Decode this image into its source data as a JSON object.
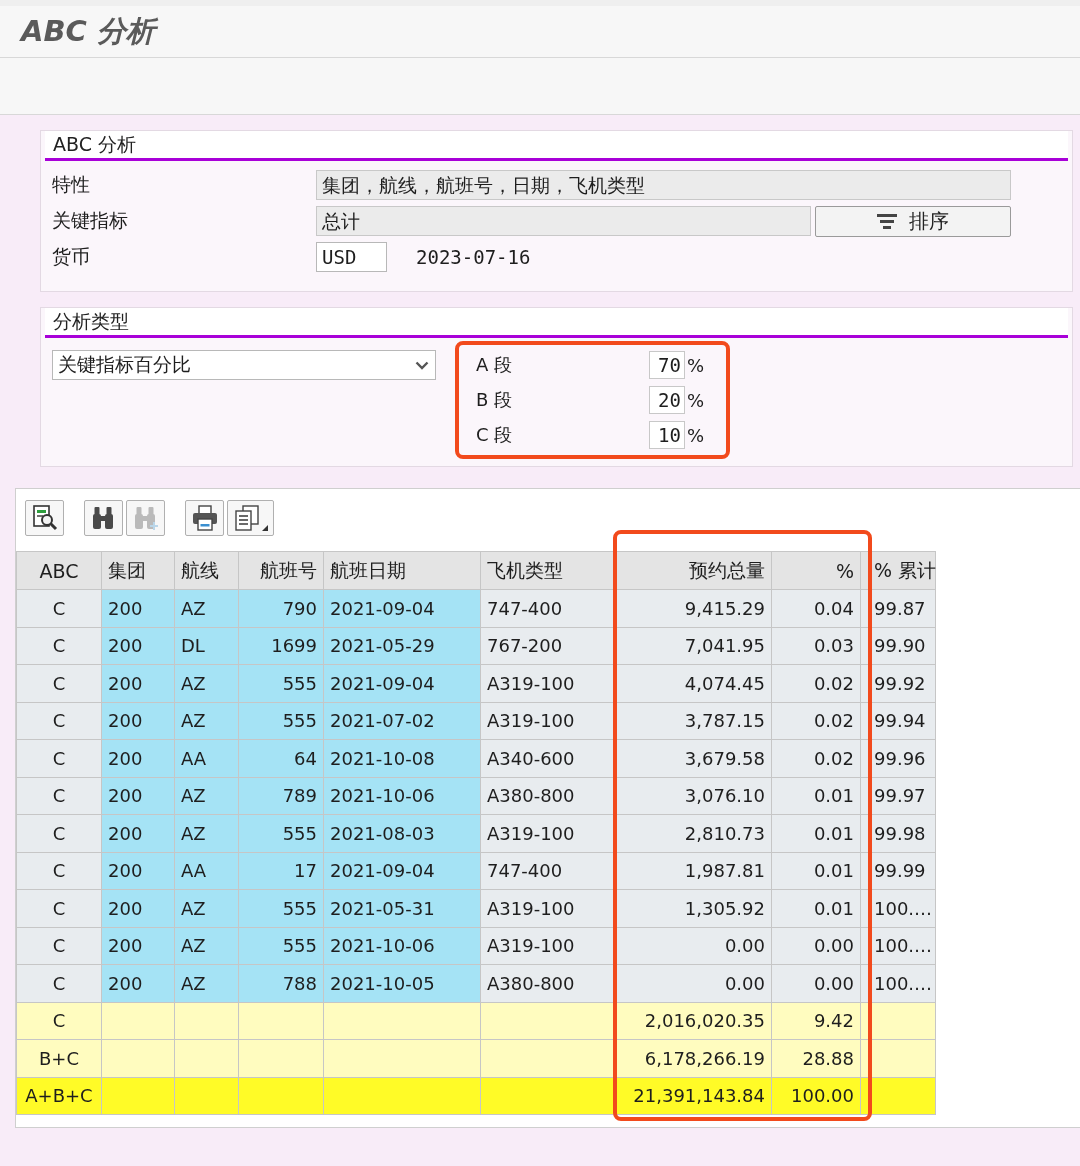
{
  "window": {
    "title": "ABC 分析"
  },
  "settings": {
    "title": "ABC 分析",
    "fields": [
      {
        "label": "特性",
        "kind": "display",
        "value": "集团，航线，航班号，日期，飞机类型"
      },
      {
        "label": "关键指标",
        "kind": "display",
        "value": "总计",
        "button": "排序"
      },
      {
        "label": "货币",
        "kind": "input",
        "value": "USD",
        "note": "2023-07-16"
      }
    ]
  },
  "analysis_type": {
    "title": "分析类型",
    "dropdown": {
      "value": "关键指标百分比"
    },
    "segments": {
      "highlighted": true,
      "items": [
        {
          "label": "A 段",
          "value": "70",
          "unit": "%"
        },
        {
          "label": "B 段",
          "value": "20",
          "unit": "%"
        },
        {
          "label": "C 段",
          "value": "10",
          "unit": "%"
        }
      ]
    }
  },
  "grid": {
    "toolbar": [
      [
        {
          "kind": "details",
          "disabled": false
        }
      ],
      [
        {
          "kind": "find",
          "disabled": false
        },
        {
          "kind": "find_next",
          "disabled": true
        }
      ],
      [
        {
          "kind": "print",
          "disabled": false
        },
        {
          "kind": "export",
          "disabled": false
        }
      ]
    ],
    "columns": [
      {
        "label": "ABC",
        "kind": "category",
        "key": false,
        "highlighted": false
      },
      {
        "label": "集团",
        "kind": "text",
        "key": true,
        "highlighted": false
      },
      {
        "label": "航线",
        "kind": "text",
        "key": true,
        "highlighted": false
      },
      {
        "label": "航班号",
        "kind": "number",
        "key": true,
        "highlighted": false
      },
      {
        "label": "航班日期",
        "kind": "text",
        "key": true,
        "highlighted": false
      },
      {
        "label": "飞机类型",
        "kind": "text",
        "key": false,
        "highlighted": false
      },
      {
        "label": "预约总量",
        "kind": "number",
        "key": false,
        "highlighted": true
      },
      {
        "label": "%",
        "kind": "number",
        "key": false,
        "highlighted": true
      },
      {
        "label": "% 累计",
        "kind": "cumulative",
        "key": false,
        "highlighted": false
      }
    ],
    "rows": [
      {
        "kind": "data",
        "cells": [
          "C",
          "200",
          "AZ",
          "790",
          "2021-09-04",
          "747-400",
          "9,415.29",
          "0.04",
          "99.87"
        ]
      },
      {
        "kind": "data",
        "cells": [
          "C",
          "200",
          "DL",
          "1699",
          "2021-05-29",
          "767-200",
          "7,041.95",
          "0.03",
          "99.90"
        ]
      },
      {
        "kind": "data",
        "cells": [
          "C",
          "200",
          "AZ",
          "555",
          "2021-09-04",
          "A319-100",
          "4,074.45",
          "0.02",
          "99.92"
        ]
      },
      {
        "kind": "data",
        "cells": [
          "C",
          "200",
          "AZ",
          "555",
          "2021-07-02",
          "A319-100",
          "3,787.15",
          "0.02",
          "99.94"
        ]
      },
      {
        "kind": "data",
        "cells": [
          "C",
          "200",
          "AA",
          "64",
          "2021-10-08",
          "A340-600",
          "3,679.58",
          "0.02",
          "99.96"
        ]
      },
      {
        "kind": "data",
        "cells": [
          "C",
          "200",
          "AZ",
          "789",
          "2021-10-06",
          "A380-800",
          "3,076.10",
          "0.01",
          "99.97"
        ]
      },
      {
        "kind": "data",
        "cells": [
          "C",
          "200",
          "AZ",
          "555",
          "2021-08-03",
          "A319-100",
          "2,810.73",
          "0.01",
          "99.98"
        ]
      },
      {
        "kind": "data",
        "cells": [
          "C",
          "200",
          "AA",
          "17",
          "2021-09-04",
          "747-400",
          "1,987.81",
          "0.01",
          "99.99"
        ]
      },
      {
        "kind": "data",
        "cells": [
          "C",
          "200",
          "AZ",
          "555",
          "2021-05-31",
          "A319-100",
          "1,305.92",
          "0.01",
          "100.…"
        ]
      },
      {
        "kind": "data",
        "cells": [
          "C",
          "200",
          "AZ",
          "555",
          "2021-10-06",
          "A319-100",
          "0.00",
          "0.00",
          "100.…"
        ]
      },
      {
        "kind": "data",
        "cells": [
          "C",
          "200",
          "AZ",
          "788",
          "2021-10-05",
          "A380-800",
          "0.00",
          "0.00",
          "100.…"
        ]
      },
      {
        "kind": "subtotal",
        "cells": [
          "C",
          null,
          null,
          null,
          null,
          null,
          "2,016,020.35",
          "9.42",
          null
        ]
      },
      {
        "kind": "subtotal",
        "cells": [
          "B+C",
          null,
          null,
          null,
          null,
          null,
          "6,178,266.19",
          "28.88",
          null
        ]
      },
      {
        "kind": "grand_total",
        "cells": [
          "A+B+C",
          null,
          null,
          null,
          null,
          null,
          "21,391,143.84",
          "100.00",
          null
        ]
      }
    ]
  }
}
